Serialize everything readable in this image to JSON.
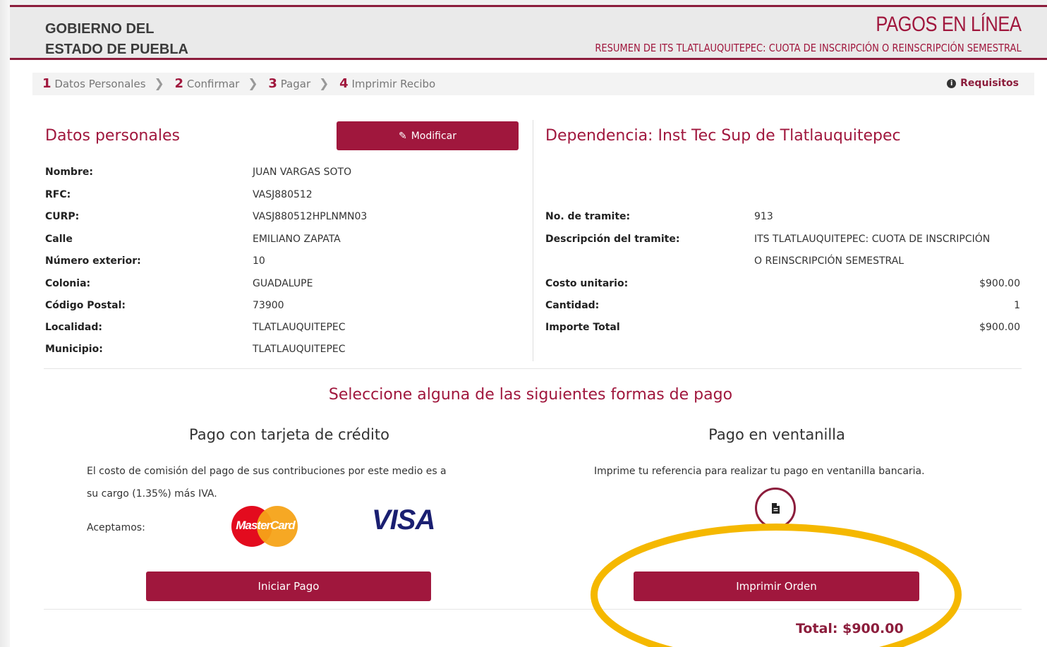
{
  "header": {
    "gov_line1": "GOBIERNO DEL",
    "gov_line2": "ESTADO DE PUEBLA",
    "title": "PAGOS EN LÍNEA",
    "subtitle": "RESUMEN DE ITS TLATLAUQUITEPEC: CUOTA DE INSCRIPCIÓN O REINSCRIPCIÓN SEMESTRAL"
  },
  "steps": [
    {
      "num": "1",
      "label": "Datos Personales"
    },
    {
      "num": "2",
      "label": "Confirmar"
    },
    {
      "num": "3",
      "label": "Pagar"
    },
    {
      "num": "4",
      "label": "Imprimir Recibo"
    }
  ],
  "requisitos": "Requisitos",
  "personal": {
    "title": "Datos personales",
    "modify_label": "Modificar",
    "rows": [
      {
        "label": "Nombre:",
        "value": "JUAN VARGAS SOTO"
      },
      {
        "label": "RFC:",
        "value": "VASJ880512"
      },
      {
        "label": "CURP:",
        "value": "VASJ880512HPLNMN03"
      },
      {
        "label": "Calle",
        "value": "EMILIANO ZAPATA"
      },
      {
        "label": "Número exterior:",
        "value": "10"
      },
      {
        "label": "Colonia:",
        "value": "GUADALUPE"
      },
      {
        "label": "Código Postal:",
        "value": "73900"
      },
      {
        "label": "Localidad:",
        "value": "TLATLAUQUITEPEC"
      },
      {
        "label": "Municipio:",
        "value": "TLATLAUQUITEPEC"
      }
    ]
  },
  "dependencia": {
    "title": "Dependencia: Inst Tec Sup de Tlatlauquitepec",
    "tramite_label": "No. de tramite:",
    "tramite_value": "913",
    "desc_label": "Descripción del tramite:",
    "desc_line1": "ITS TLATLAUQUITEPEC: CUOTA DE INSCRIPCIÓN",
    "desc_line2": "O REINSCRIPCIÓN SEMESTRAL",
    "costo_label": "Costo unitario:",
    "costo_value": "$900.00",
    "cantidad_label": "Cantidad:",
    "cantidad_value": "1",
    "importe_label": "Importe Total",
    "importe_value": "$900.00"
  },
  "payment": {
    "select_title": "Seleccione alguna de las siguientes formas de pago",
    "card_title": "Pago con tarjeta de crédito",
    "card_text_line1": "El costo de comisión del pago de sus contribuciones por este medio es a",
    "card_text_line2": "su cargo (1.35%) más IVA.",
    "aceptamos": "Aceptamos:",
    "mastercard": "MasterCard",
    "visa": "VISA",
    "iniciar_label": "Iniciar Pago",
    "window_title": "Pago en ventanilla",
    "window_text": "Imprime tu referencia para realizar tu pago en ventanilla bancaria.",
    "imprimir_label": "Imprimir Orden",
    "total": "Total: $900.00"
  },
  "colors": {
    "accent": "#a0173d",
    "highlight": "#f5b800"
  }
}
